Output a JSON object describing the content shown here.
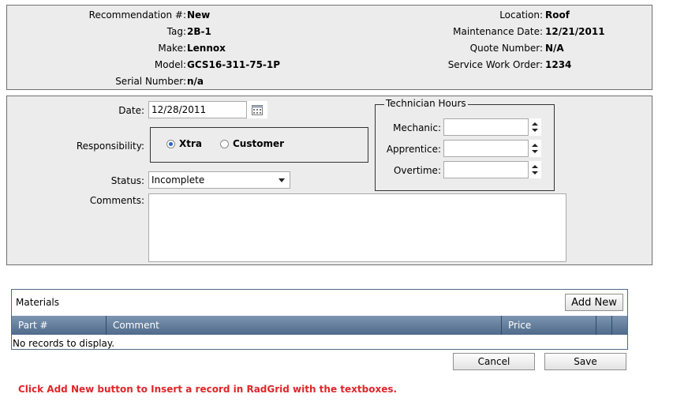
{
  "info": {
    "recommendation_label": "Recommendation #:",
    "recommendation_value": "New",
    "tag_label": "Tag:",
    "tag_value": "2B-1",
    "make_label": "Make:",
    "make_value": "Lennox",
    "model_label": "Model:",
    "model_value": "GCS16-311-75-1P",
    "serial_label": "Serial Number:",
    "serial_value": "n/a",
    "location_label": "Location:",
    "location_value": "Roof",
    "maintenance_label": "Maintenance Date:",
    "maintenance_value": "12/21/2011",
    "quote_label": "Quote Number:",
    "quote_value": "N/A",
    "service_label": "Service Work Order:",
    "service_value": "1234"
  },
  "form": {
    "date_label": "Date:",
    "date_value": "12/28/2011",
    "responsibility_label": "Responsibility:",
    "responsibility_options": [
      "Xtra",
      "Customer"
    ],
    "responsibility_selected": "Xtra",
    "status_label": "Status:",
    "status_value": "Incomplete",
    "comments_label": "Comments:",
    "comments_value": "",
    "technician_legend": "Technician Hours",
    "mechanic_label": "Mechanic:",
    "mechanic_value": "",
    "apprentice_label": "Apprentice:",
    "apprentice_value": "",
    "overtime_label": "Overtime:",
    "overtime_value": ""
  },
  "materials": {
    "title": "Materials",
    "add_new_label": "Add New",
    "columns": [
      "Part #",
      "Comment",
      "Price"
    ],
    "empty_text": "No records to display."
  },
  "actions": {
    "cancel_label": "Cancel",
    "save_label": "Save"
  },
  "note": "Click Add New button to Insert a record in RadGrid with the textboxes.",
  "colors": {
    "panel_bg": "#ececec",
    "grid_header": "#5d7898",
    "note_text": "#e0262a",
    "radio_selected": "#2b63c6"
  }
}
